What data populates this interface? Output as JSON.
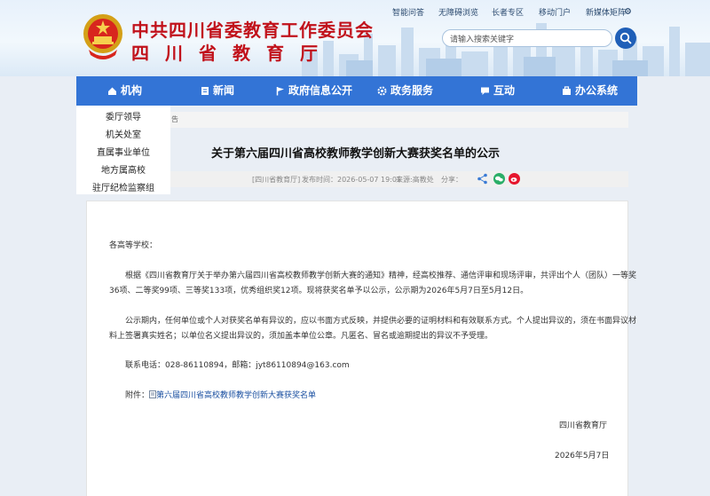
{
  "header": {
    "title_main": "中共四川省委教育工作委员会",
    "title_sub": "四川省教育厅",
    "top_links": [
      "智能问答",
      "无障碍浏览",
      "长者专区",
      "移动门户",
      "新媒体矩阵"
    ],
    "search_placeholder": "请输入搜索关键字"
  },
  "nav": {
    "items": [
      {
        "label": "机构",
        "icon": "home-icon"
      },
      {
        "label": "新闻",
        "icon": "document-icon"
      },
      {
        "label": "政府信息公开",
        "icon": "flag-icon"
      },
      {
        "label": "政务服务",
        "icon": "gear-icon"
      },
      {
        "label": "互动",
        "icon": "chat-icon"
      },
      {
        "label": "办公系统",
        "icon": "office-icon"
      }
    ]
  },
  "sidebar": {
    "items": [
      "委厅领导",
      "机关处室",
      "直属事业单位",
      "地方属高校",
      "驻厅纪检监察组"
    ]
  },
  "article": {
    "breadcrumb": "告",
    "title": "关于第六届四川省高校教师教学创新大赛获奖名单的公示",
    "source_tag": "[四川省教育厅]",
    "publish_time": "发布时间：2026-05-07 19:01",
    "origin": "来源:高教处",
    "share_label": "分享：",
    "salutation": "各高等学校：",
    "para1_line1": "根据《四川省教育厅关于举办第六届四川省高校教师教学创新大赛的通知》精神，经高校推荐、通信评审和现场评审，共评出个人（团队）一等奖",
    "para1_line2": "36项、二等奖99项、三等奖133项，优秀组织奖12项。现将获奖名单予以公示，公示期为2026年5月7日至5月12日。",
    "para2_line1": "公示期内，任何单位或个人对获奖名单有异议的，应以书面方式反映，并提供必要的证明材料和有效联系方式。个人提出异议的，须在书面异议材",
    "para2_line2": "料上签署真实姓名；以单位名义提出异议的，须加盖本单位公章。凡匿名、冒名或逾期提出的异议不予受理。",
    "contact": "联系电话：028-86110894，邮箱：jyt86110894@163.com",
    "attachment_label": "附件：",
    "attachment_name": "第六届四川省高校教师教学创新大赛获奖名单",
    "signature": "四川省教育厅",
    "date": "2026年5月7日"
  },
  "colors": {
    "brand_red": "#c1121b",
    "nav_blue": "#3374d6",
    "link_blue": "#1a4fa0"
  }
}
